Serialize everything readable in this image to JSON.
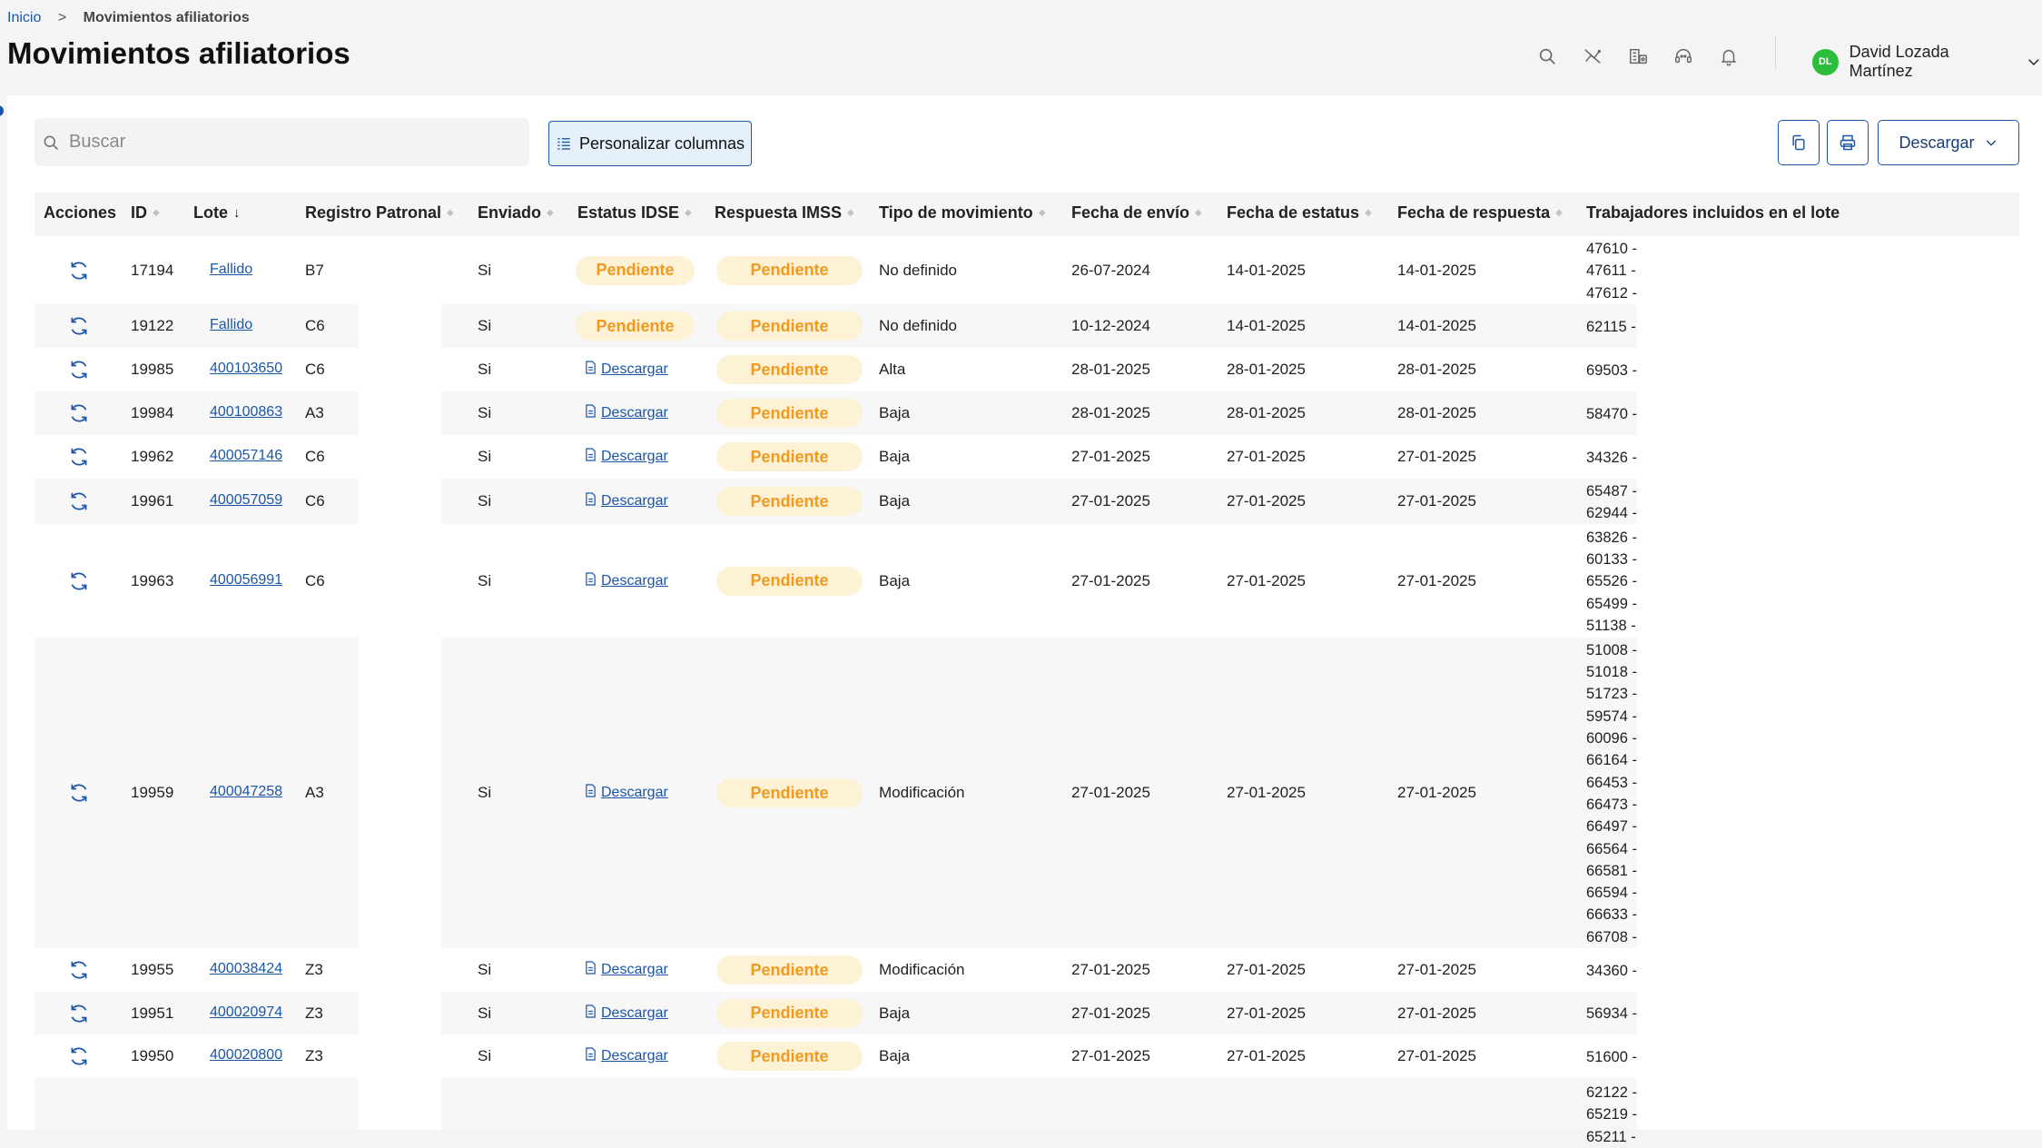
{
  "breadcrumb": {
    "home": "Inicio",
    "separator": ">",
    "current": "Movimientos afiliatorios"
  },
  "page_title": "Movimientos afiliatorios",
  "user": {
    "initials": "DL",
    "name": "David Lozada Martínez"
  },
  "header_icons": [
    "search-icon",
    "no-signal-icon",
    "building-money-icon",
    "headset-icon",
    "bell-icon"
  ],
  "toolbar": {
    "search_placeholder": "Buscar",
    "customize_columns": "Personalizar columnas",
    "download": "Descargar"
  },
  "table": {
    "headers": {
      "acciones": "Acciones",
      "id": "ID",
      "lote": "Lote",
      "registro": "Registro Patronal",
      "enviado": "Enviado",
      "estatus": "Estatus IDSE",
      "respuesta": "Respuesta IMSS",
      "tipo": "Tipo de movimiento",
      "fecha_envio": "Fecha de envío",
      "fecha_estatus": "Fecha de estatus",
      "fecha_respuesta": "Fecha de respuesta",
      "trabajadores": "Trabajadores incluidos en el lote"
    },
    "rows": [
      {
        "id": "17194",
        "lote": "Fallido",
        "registro": "B7",
        "enviado": "Si",
        "estatus": "Pendiente",
        "respuesta": "Pendiente",
        "tipo": "No definido",
        "fecha_envio": "26-07-2024",
        "fecha_estatus": "14-01-2025",
        "fecha_respuesta": "14-01-2025",
        "trabajadores": [
          "47610 -",
          "47611 -",
          "47612 -"
        ]
      },
      {
        "id": "19122",
        "lote": "Fallido",
        "registro": "C6",
        "enviado": "Si",
        "estatus": "Pendiente",
        "respuesta": "Pendiente",
        "tipo": "No definido",
        "fecha_envio": "10-12-2024",
        "fecha_estatus": "14-01-2025",
        "fecha_respuesta": "14-01-2025",
        "trabajadores": [
          "62115 -"
        ]
      },
      {
        "id": "19985",
        "lote": "400103650",
        "registro": "C6",
        "enviado": "Si",
        "estatus": "Descargar",
        "respuesta": "Pendiente",
        "tipo": "Alta",
        "fecha_envio": "28-01-2025",
        "fecha_estatus": "28-01-2025",
        "fecha_respuesta": "28-01-2025",
        "trabajadores": [
          "69503 -"
        ]
      },
      {
        "id": "19984",
        "lote": "400100863",
        "registro": "A3",
        "enviado": "Si",
        "estatus": "Descargar",
        "respuesta": "Pendiente",
        "tipo": "Baja",
        "fecha_envio": "28-01-2025",
        "fecha_estatus": "28-01-2025",
        "fecha_respuesta": "28-01-2025",
        "trabajadores": [
          "58470 -"
        ]
      },
      {
        "id": "19962",
        "lote": "400057146",
        "registro": "C6",
        "enviado": "Si",
        "estatus": "Descargar",
        "respuesta": "Pendiente",
        "tipo": "Baja",
        "fecha_envio": "27-01-2025",
        "fecha_estatus": "27-01-2025",
        "fecha_respuesta": "27-01-2025",
        "trabajadores": [
          "34326 -"
        ]
      },
      {
        "id": "19961",
        "lote": "400057059",
        "registro": "C6",
        "enviado": "Si",
        "estatus": "Descargar",
        "respuesta": "Pendiente",
        "tipo": "Baja",
        "fecha_envio": "27-01-2025",
        "fecha_estatus": "27-01-2025",
        "fecha_respuesta": "27-01-2025",
        "trabajadores": [
          "65487 -",
          "62944 -"
        ]
      },
      {
        "id": "19963",
        "lote": "400056991",
        "registro": "C6",
        "enviado": "Si",
        "estatus": "Descargar",
        "respuesta": "Pendiente",
        "tipo": "Baja",
        "fecha_envio": "27-01-2025",
        "fecha_estatus": "27-01-2025",
        "fecha_respuesta": "27-01-2025",
        "trabajadores": [
          "63826 -",
          "60133 -",
          "65526 -",
          "65499 -",
          "51138 -"
        ]
      },
      {
        "id": "19959",
        "lote": "400047258",
        "registro": "A3",
        "enviado": "Si",
        "estatus": "Descargar",
        "respuesta": "Pendiente",
        "tipo": "Modificación",
        "fecha_envio": "27-01-2025",
        "fecha_estatus": "27-01-2025",
        "fecha_respuesta": "27-01-2025",
        "trabajadores": [
          "51008 -",
          "51018 -",
          "51723 -",
          "59574 -",
          "60096 -",
          "66164 -",
          "66453 -",
          "66473 -",
          "66497 -",
          "66564 -",
          "66581 -",
          "66594 -",
          "66633 -",
          "66708 -"
        ]
      },
      {
        "id": "19955",
        "lote": "400038424",
        "registro": "Z3",
        "enviado": "Si",
        "estatus": "Descargar",
        "respuesta": "Pendiente",
        "tipo": "Modificación",
        "fecha_envio": "27-01-2025",
        "fecha_estatus": "27-01-2025",
        "fecha_respuesta": "27-01-2025",
        "trabajadores": [
          "34360 -"
        ]
      },
      {
        "id": "19951",
        "lote": "400020974",
        "registro": "Z3",
        "enviado": "Si",
        "estatus": "Descargar",
        "respuesta": "Pendiente",
        "tipo": "Baja",
        "fecha_envio": "27-01-2025",
        "fecha_estatus": "27-01-2025",
        "fecha_respuesta": "27-01-2025",
        "trabajadores": [
          "56934 -"
        ]
      },
      {
        "id": "19950",
        "lote": "400020800",
        "registro": "Z3",
        "enviado": "Si",
        "estatus": "Descargar",
        "respuesta": "Pendiente",
        "tipo": "Baja",
        "fecha_envio": "27-01-2025",
        "fecha_estatus": "27-01-2025",
        "fecha_respuesta": "27-01-2025",
        "trabajadores": [
          "51600 -"
        ]
      },
      {
        "id": "",
        "lote": "",
        "registro": "",
        "enviado": "",
        "estatus": "",
        "respuesta": "",
        "tipo": "",
        "fecha_envio": "",
        "fecha_estatus": "",
        "fecha_respuesta": "",
        "trabajadores": [
          "62122 -",
          "65219 -",
          "65211 -"
        ]
      }
    ]
  },
  "colors": {
    "accent": "#1a56a8",
    "pending_text": "#f39a1e",
    "pending_bg": "#fdf1d6",
    "avatar": "#2bbd3c"
  }
}
